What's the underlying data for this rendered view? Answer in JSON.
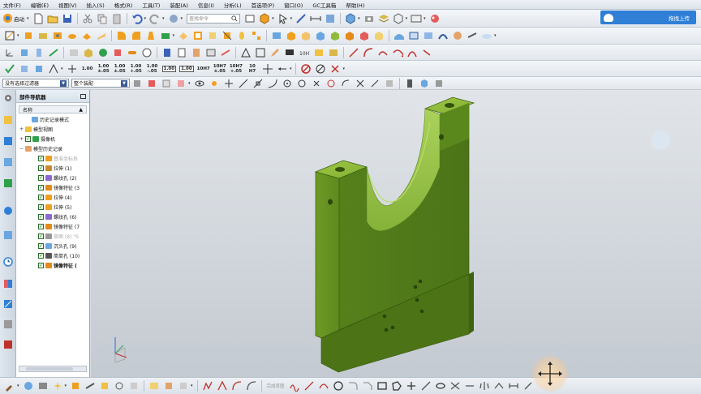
{
  "menubar": {
    "items": [
      "文件(F)",
      "编辑(E)",
      "视图(V)",
      "插入(S)",
      "格式(R)",
      "工具(T)",
      "装配(A)",
      "信息(I)",
      "分析(L)",
      "首选项(P)",
      "窗口(O)",
      "GC工具箱",
      "帮助(H)"
    ]
  },
  "toolbar1": {
    "start_label": "启动",
    "search_placeholder": "查找命令",
    "cloud_label": "拖拽上传"
  },
  "toolbar4": {
    "dimension_labels": [
      "1.00",
      "1.00\n±.05",
      "1.00\n±.05",
      "1.00\n+.05",
      "1.00\n-.05",
      "1.00",
      "1.00",
      "10H7",
      "10H7\n±.05",
      "10H7\n+.05",
      "10\nH7"
    ]
  },
  "toolbar5": {
    "filter_value": "没有选择过滤器",
    "assembly_value": "整个装配"
  },
  "navigator": {
    "title": "部件导航器",
    "column_header": "名称",
    "tree": [
      {
        "label": "历史记录模式",
        "indent": 1,
        "expander": "",
        "check": false,
        "dim": false,
        "bold": false
      },
      {
        "label": "模型视图",
        "indent": 0,
        "expander": "+",
        "check": false,
        "dim": false,
        "bold": false
      },
      {
        "label": "摄像机",
        "indent": 0,
        "expander": "+",
        "check": true,
        "dim": false,
        "bold": false
      },
      {
        "label": "模型历史记录",
        "indent": 0,
        "expander": "−",
        "check": false,
        "dim": false,
        "bold": false
      },
      {
        "label": "基准坐标系",
        "indent": 2,
        "expander": "",
        "check": true,
        "dim": true,
        "bold": false
      },
      {
        "label": "拉伸 (1)",
        "indent": 2,
        "expander": "",
        "check": true,
        "dim": false,
        "bold": false
      },
      {
        "label": "螺纹孔 (2)",
        "indent": 2,
        "expander": "",
        "check": true,
        "dim": false,
        "bold": false
      },
      {
        "label": "镜像特征 (3",
        "indent": 2,
        "expander": "",
        "check": true,
        "dim": false,
        "bold": false
      },
      {
        "label": "拉伸 (4)",
        "indent": 2,
        "expander": "",
        "check": true,
        "dim": false,
        "bold": false
      },
      {
        "label": "拉伸 (5)",
        "indent": 2,
        "expander": "",
        "check": true,
        "dim": false,
        "bold": false
      },
      {
        "label": "螺纹孔 (6)",
        "indent": 2,
        "expander": "",
        "check": true,
        "dim": false,
        "bold": false
      },
      {
        "label": "镜像特征 (7",
        "indent": 2,
        "expander": "",
        "check": true,
        "dim": false,
        "bold": false
      },
      {
        "label": "草图 (8) \"S",
        "indent": 2,
        "expander": "",
        "check": true,
        "dim": true,
        "bold": false
      },
      {
        "label": "沉头孔 (9)",
        "indent": 2,
        "expander": "",
        "check": true,
        "dim": false,
        "bold": false
      },
      {
        "label": "简单孔 (10)",
        "indent": 2,
        "expander": "",
        "check": true,
        "dim": false,
        "bold": false
      },
      {
        "label": "镜像特征 (",
        "indent": 2,
        "expander": "",
        "check": true,
        "dim": false,
        "bold": true
      }
    ]
  },
  "bottom_bar": {
    "sketch_label": "完成草图"
  },
  "colors": {
    "model_green": "#5f8a1e",
    "model_dark": "#3e5f10",
    "model_light": "#8fbb3a",
    "accent_blue": "#2f7fd6"
  }
}
